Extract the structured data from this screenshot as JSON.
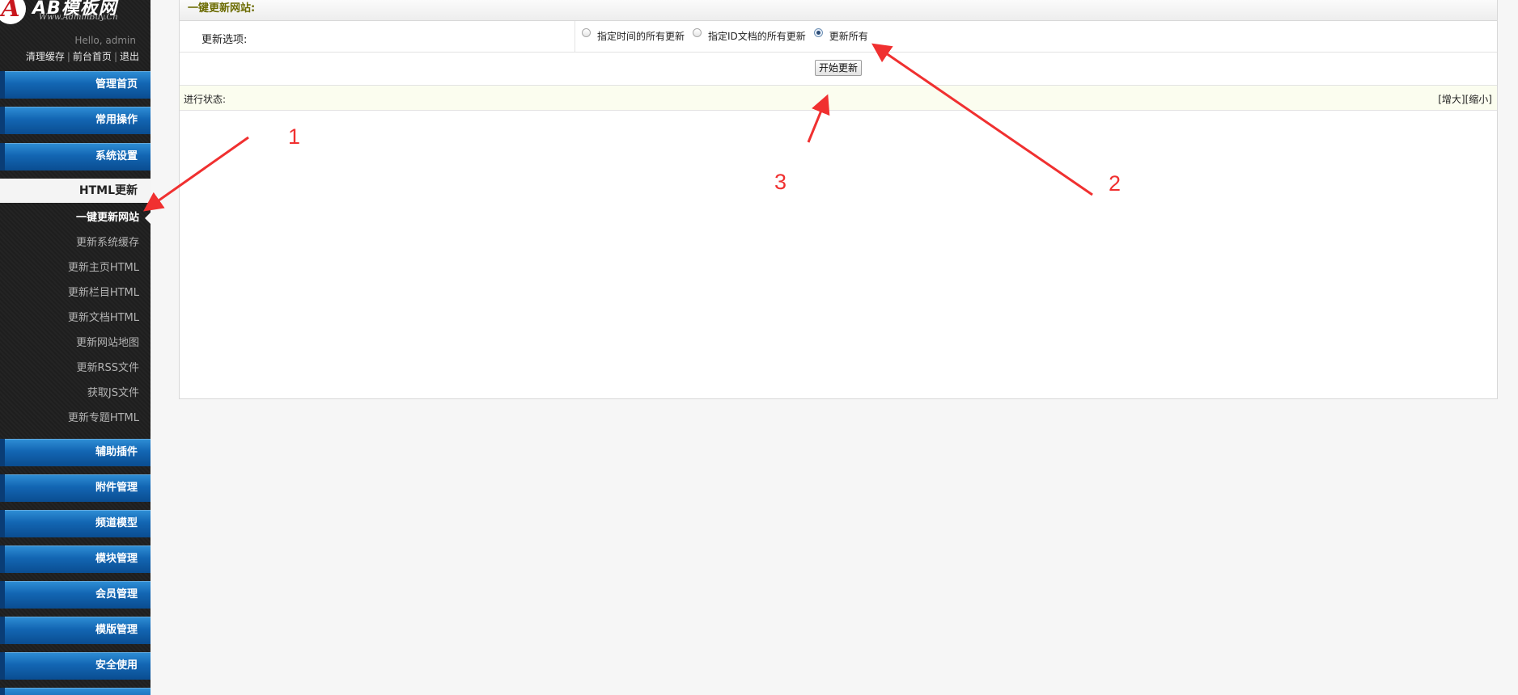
{
  "sidebar": {
    "logo_letter": "A",
    "logo_text": "AB模板网",
    "logo_sub": "Www.AdminBuy.Cn",
    "hello": "Hello, admin",
    "links": [
      "清理缓存",
      "前台首页",
      "退出"
    ],
    "nav_top": [
      "管理首页",
      "常用操作",
      "系统设置"
    ],
    "section": "HTML更新",
    "sub_items": [
      "一键更新网站",
      "更新系统缓存",
      "更新主页HTML",
      "更新栏目HTML",
      "更新文档HTML",
      "更新网站地图",
      "更新RSS文件",
      "获取JS文件",
      "更新专题HTML"
    ],
    "nav_bottom": [
      "辅助插件",
      "附件管理",
      "频道模型",
      "模块管理",
      "会员管理",
      "模版管理",
      "安全使用"
    ]
  },
  "main": {
    "title": "一键更新网站:",
    "option_label": "更新选项:",
    "options": [
      "指定时间的所有更新",
      "指定ID文档的所有更新",
      "更新所有"
    ],
    "selected_option": 2,
    "start_button": "开始更新",
    "status_label": "进行状态:",
    "zoom_in": "[增大]",
    "zoom_out": "[缩小]"
  },
  "annotations": {
    "labels": [
      "1",
      "2",
      "3"
    ],
    "color": "#f03030"
  }
}
